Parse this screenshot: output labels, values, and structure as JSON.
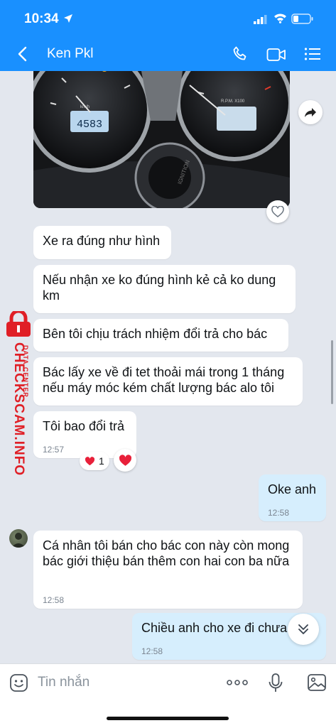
{
  "status_bar": {
    "time": "10:34"
  },
  "header": {
    "contact_name": "Ken Pkl"
  },
  "photo": {
    "odometer": "4583",
    "rpm_label": "R.P.M. X100",
    "speed_unit": "km/h",
    "ignition": "IGNITION"
  },
  "messages": [
    {
      "text": "Xe ra đúng như hình"
    },
    {
      "text": "Nếu nhận xe ko đúng hình kẻ cả ko dung km"
    },
    {
      "text": "Bên tôi chịu trách nhiệm đổi trả cho bác"
    },
    {
      "text": "Bác lấy xe về đi tet thoải mái trong 1 tháng nếu máy móc kém chất lượng bác alo tôi"
    },
    {
      "text": "Tôi bao đổi trả",
      "time": "12:57",
      "reaction_count": "1"
    },
    {
      "text": "Oke anh",
      "time": "12:58",
      "sender": "me"
    },
    {
      "text": "Cá nhân tôi bán cho bác con này còn mong bác giới thiệu bán thêm con hai con ba nữa",
      "time": "12:58"
    },
    {
      "text": "Chiều anh cho xe đi chưa",
      "time": "12:58",
      "sender": "me"
    }
  ],
  "watermark": {
    "main": "CHECKSCAM.INFO",
    "sub": "DATA CENTER"
  },
  "input": {
    "placeholder": "Tin nhắn"
  },
  "colors": {
    "header": "#1990ff",
    "chat_bg": "#e3e7ee",
    "my_bubble": "#d6eefd",
    "heart": "#e8203a",
    "watermark": "#e01f26"
  }
}
